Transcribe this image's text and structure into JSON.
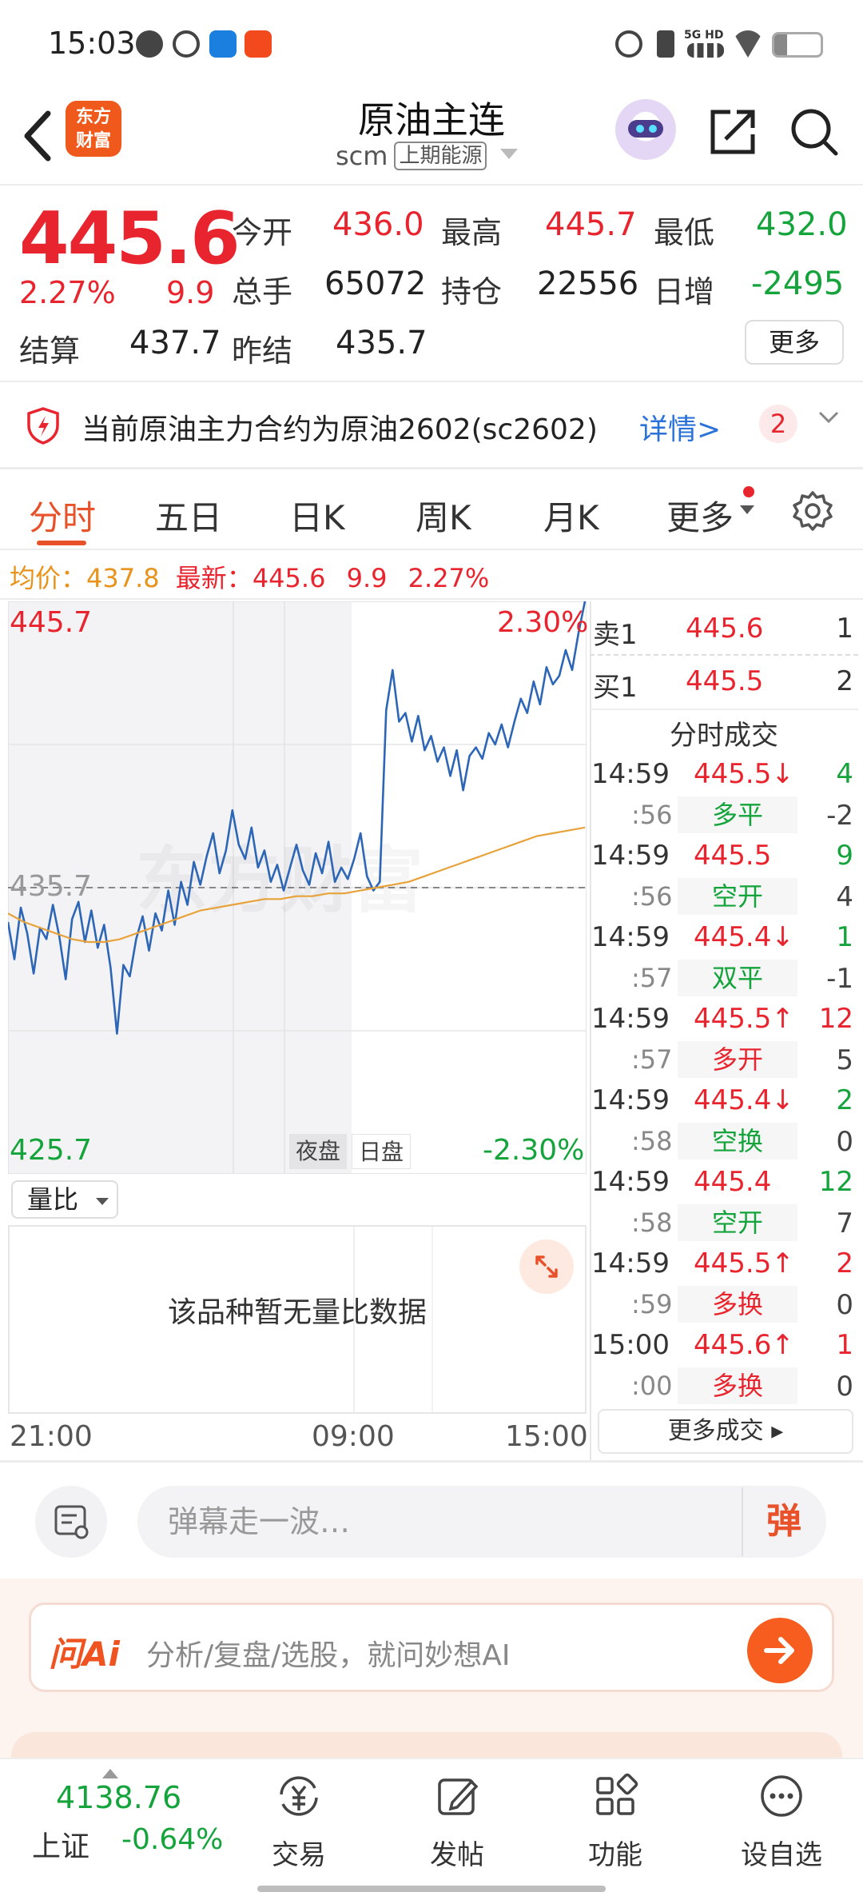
{
  "status_bar": {
    "time": "15:03",
    "network": "5G HD"
  },
  "header": {
    "brand": "东方财富",
    "title": "原油主连",
    "code": "scm",
    "exchange": "上期能源"
  },
  "quote": {
    "price": "445.6",
    "change_pct": "2.27%",
    "change": "9.9",
    "open_label": "今开",
    "open": "436.0",
    "high_label": "最高",
    "high": "445.7",
    "low_label": "最低",
    "low": "432.0",
    "volume_label": "总手",
    "volume": "65072",
    "oi_label": "持仓",
    "oi": "22556",
    "daily_inc_label": "日增",
    "daily_inc": "-2495",
    "settle_label": "结算",
    "settle": "437.7",
    "prev_settle_label": "昨结",
    "prev_settle": "435.7",
    "more_label": "更多"
  },
  "notice": {
    "text": "当前原油主力合约为原油2602(sc2602)",
    "details": "详情>",
    "count": "2"
  },
  "tabs": [
    "分时",
    "五日",
    "日K",
    "周K",
    "月K",
    "更多"
  ],
  "avg_line": {
    "avg_label": "均价：",
    "avg": "437.8",
    "latest_label": "最新：",
    "latest": "445.6",
    "change": "9.9",
    "change_pct": "2.27%"
  },
  "chart_labels": {
    "top_price": "445.7",
    "top_pct": "2.30%",
    "bottom_price": "425.7",
    "bottom_pct": "-2.30%",
    "mid_price": "435.7",
    "night_session": "夜盘",
    "day_session": "日盘",
    "watermark": "东方财富"
  },
  "chart_data": {
    "type": "line",
    "x_ticks": [
      "21:00",
      "09:00",
      "15:00"
    ],
    "ylim": [
      425.7,
      445.7
    ],
    "reference": 435.7,
    "series": [
      {
        "values": [
          434.5,
          433.2,
          435.0,
          434.1,
          432.7,
          434.3,
          433.9,
          435.1,
          434.0,
          432.5,
          434.6,
          435.2,
          433.8,
          434.9,
          433.6,
          434.4,
          432.9,
          430.6,
          433.0,
          432.6,
          433.9,
          434.7,
          433.5,
          434.8,
          434.2,
          435.6,
          434.4,
          435.9,
          435.1,
          436.6,
          435.8,
          436.8,
          437.6,
          436.2,
          437.0,
          438.4,
          437.2,
          436.7,
          437.8,
          436.4,
          437.0,
          435.9,
          436.5,
          435.6,
          436.4,
          437.2,
          436.3,
          435.8,
          436.9,
          436.2,
          437.3,
          435.9,
          436.4,
          436.0,
          436.7,
          437.6,
          436.1,
          435.6,
          435.9,
          441.9,
          443.3,
          441.5,
          441.8,
          440.8,
          441.7,
          440.5,
          441.0,
          440.1,
          440.6,
          439.6,
          440.5,
          439.1,
          440.3,
          440.6,
          440.2,
          441.1,
          440.7,
          441.4,
          440.6,
          441.5,
          442.3,
          441.8,
          442.9,
          442.1,
          443.4,
          442.8,
          443.1,
          444.0,
          443.3,
          444.6,
          445.7
        ]
      },
      {
        "values": [
          434.8,
          434.5,
          434.3,
          434.1,
          433.9,
          433.8,
          433.8,
          433.9,
          434.1,
          434.3,
          434.5,
          434.7,
          434.9,
          435.0,
          435.1,
          435.2,
          435.3,
          435.3,
          435.4,
          435.4,
          435.5,
          435.5,
          435.6,
          435.7,
          435.8,
          435.9,
          436.1,
          436.3,
          436.5,
          436.7,
          436.9,
          437.1,
          437.3,
          437.5,
          437.6,
          437.7,
          437.8
        ]
      }
    ]
  },
  "lower_panel": {
    "select": "量比",
    "empty_msg": "该品种暂无量比数据"
  },
  "order_book": {
    "sell": {
      "label": "卖1",
      "price": "445.6",
      "qty": "1"
    },
    "buy": {
      "label": "买1",
      "price": "445.5",
      "qty": "2"
    },
    "trades_header": "分时成交",
    "trades": [
      {
        "time": "14:59",
        "price": "445.5↓",
        "qty": "4",
        "sub_time": ":56",
        "type": "多平",
        "type_color": "green",
        "price_color": "red",
        "qty_color": "green",
        "sub_qty": "-2"
      },
      {
        "time": "14:59",
        "price": "445.5",
        "qty": "9",
        "sub_time": ":56",
        "type": "空开",
        "type_color": "green",
        "price_color": "red",
        "qty_color": "green",
        "sub_qty": "4"
      },
      {
        "time": "14:59",
        "price": "445.4↓",
        "qty": "1",
        "sub_time": ":57",
        "type": "双平",
        "type_color": "green",
        "price_color": "red",
        "qty_color": "green",
        "sub_qty": "-1"
      },
      {
        "time": "14:59",
        "price": "445.5↑",
        "qty": "12",
        "sub_time": ":57",
        "type": "多开",
        "type_color": "red",
        "price_color": "red",
        "qty_color": "red",
        "sub_qty": "5"
      },
      {
        "time": "14:59",
        "price": "445.4↓",
        "qty": "2",
        "sub_time": ":58",
        "type": "空换",
        "type_color": "green",
        "price_color": "red",
        "qty_color": "green",
        "sub_qty": "0"
      },
      {
        "time": "14:59",
        "price": "445.4",
        "qty": "12",
        "sub_time": ":58",
        "type": "空开",
        "type_color": "green",
        "price_color": "red",
        "qty_color": "green",
        "sub_qty": "7"
      },
      {
        "time": "14:59",
        "price": "445.5↑",
        "qty": "2",
        "sub_time": ":59",
        "type": "多换",
        "type_color": "red",
        "price_color": "red",
        "qty_color": "red",
        "sub_qty": "0"
      },
      {
        "time": "15:00",
        "price": "445.6↑",
        "qty": "1",
        "sub_time": ":00",
        "type": "多换",
        "type_color": "red",
        "price_color": "red",
        "qty_color": "red",
        "sub_qty": "0"
      }
    ],
    "more_trades": "更多成交 ▸"
  },
  "comment": {
    "placeholder": "弹幕走一波…",
    "danmu": "弹"
  },
  "ai": {
    "brand": "问Ai",
    "placeholder": "分析/复盘/选股，就问妙想AI"
  },
  "bottom_nav": {
    "index_value": "4138.76",
    "index_name": "上证",
    "index_change": "-0.64%",
    "items": [
      "交易",
      "发帖",
      "功能",
      "设自选"
    ]
  },
  "colors": {
    "up": "#e8252f",
    "down": "#15a33c",
    "accent": "#e8522a",
    "avg_line": "#e8a23a",
    "price_line": "#2d66b7"
  }
}
